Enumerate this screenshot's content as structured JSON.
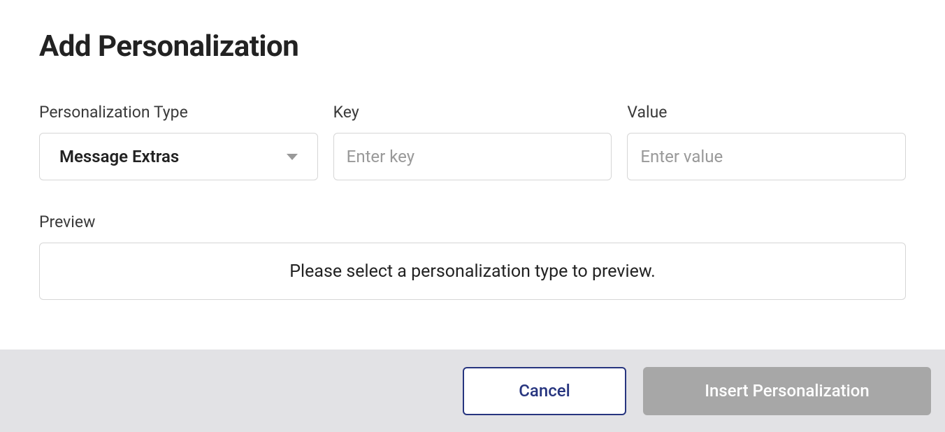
{
  "title": "Add Personalization",
  "form": {
    "type": {
      "label": "Personalization Type",
      "selected": "Message Extras"
    },
    "key": {
      "label": "Key",
      "value": "",
      "placeholder": "Enter key"
    },
    "value": {
      "label": "Value",
      "value": "",
      "placeholder": "Enter value"
    }
  },
  "preview": {
    "label": "Preview",
    "message": "Please select a personalization type to preview."
  },
  "footer": {
    "cancel": "Cancel",
    "insert": "Insert Personalization"
  }
}
